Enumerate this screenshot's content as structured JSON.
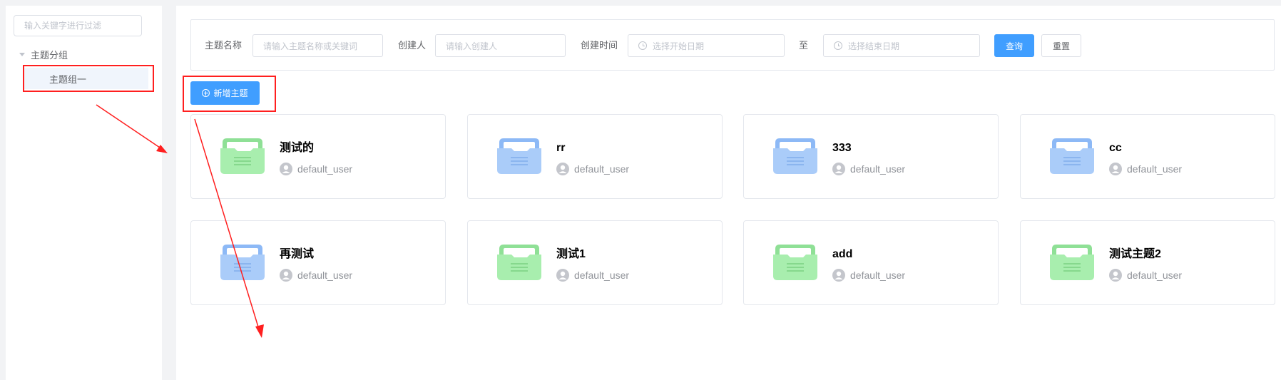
{
  "sidebar": {
    "filter_placeholder": "输入关键字进行过滤",
    "tree": {
      "root_label": "主题分组",
      "child_label": "主题组一"
    }
  },
  "search": {
    "name_label": "主题名称",
    "name_placeholder": "请输入主题名称或关键词",
    "creator_label": "创建人",
    "creator_placeholder": "请输入创建人",
    "time_label": "创建时间",
    "start_placeholder": "选择开始日期",
    "range_separator": "至",
    "end_placeholder": "选择结束日期",
    "query_label": "查询",
    "reset_label": "重置"
  },
  "toolbar": {
    "add_label": "新增主题"
  },
  "cards": [
    {
      "title": "测试的",
      "user": "default_user",
      "color": "green"
    },
    {
      "title": "rr",
      "user": "default_user",
      "color": "blue"
    },
    {
      "title": "333",
      "user": "default_user",
      "color": "blue"
    },
    {
      "title": "cc",
      "user": "default_user",
      "color": "blue"
    },
    {
      "title": "再测试",
      "user": "default_user",
      "color": "blue"
    },
    {
      "title": "测试1",
      "user": "default_user",
      "color": "green"
    },
    {
      "title": "add",
      "user": "default_user",
      "color": "green"
    },
    {
      "title": "测试主题2",
      "user": "default_user",
      "color": "green"
    }
  ],
  "colors": {
    "primary": "#409eff",
    "folder_green": "#a3e9a8",
    "folder_blue": "#a6c8f8",
    "annotation_red": "#ff1f1f"
  }
}
